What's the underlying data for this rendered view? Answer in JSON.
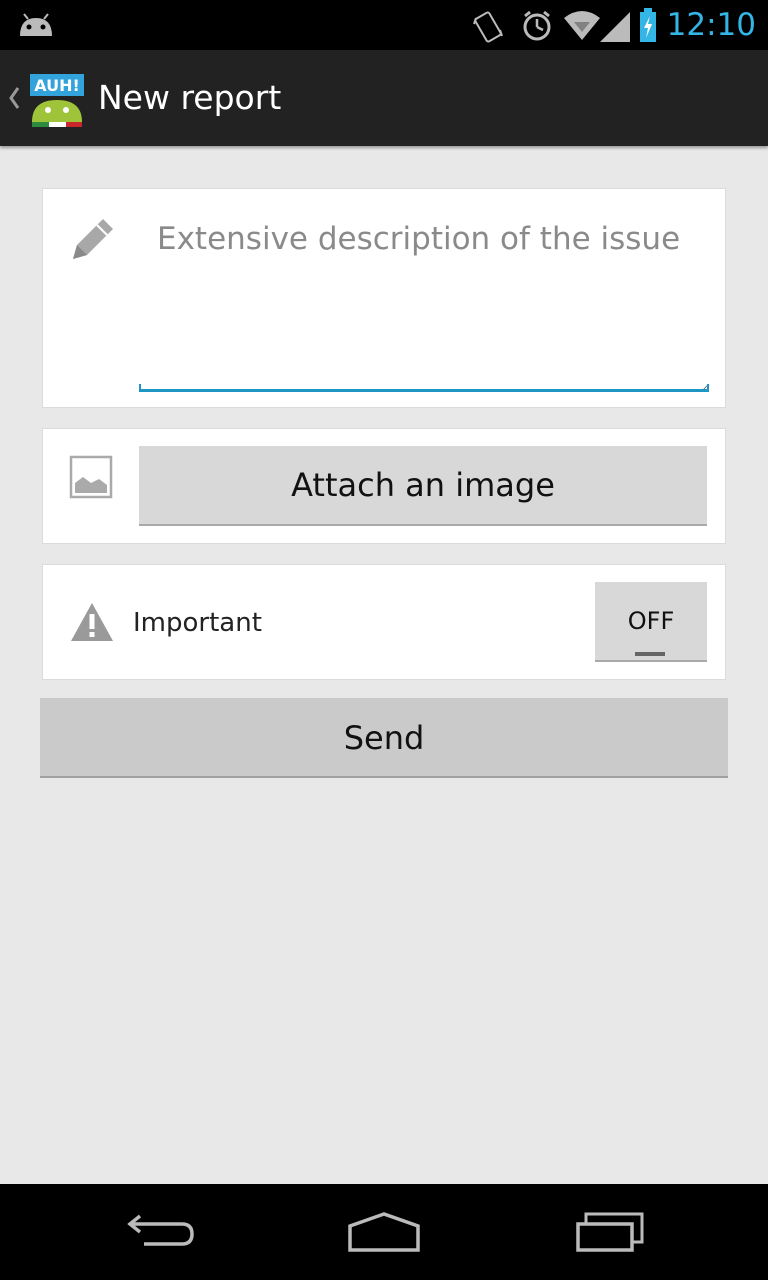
{
  "status_bar": {
    "time": "12:10",
    "icons": [
      "android-robot-icon",
      "vibrate-icon",
      "alarm-icon",
      "wifi-icon",
      "signal-icon",
      "battery-charging-icon"
    ],
    "accent_color": "#33b5e5"
  },
  "action_bar": {
    "title": "New report",
    "app_icon_text": "AUH!"
  },
  "description": {
    "placeholder": "Extensive description of the issue",
    "value": "",
    "icon": "pencil-icon",
    "underline_color": "#1d96c4"
  },
  "attach": {
    "icon": "image-icon",
    "button_label": "Attach an image"
  },
  "important": {
    "icon": "warning-icon",
    "label": "Important",
    "toggle_label": "OFF",
    "toggle_state": false
  },
  "send": {
    "button_label": "Send"
  },
  "nav_bar": {
    "items": [
      "back-icon",
      "home-icon",
      "recents-icon"
    ]
  }
}
